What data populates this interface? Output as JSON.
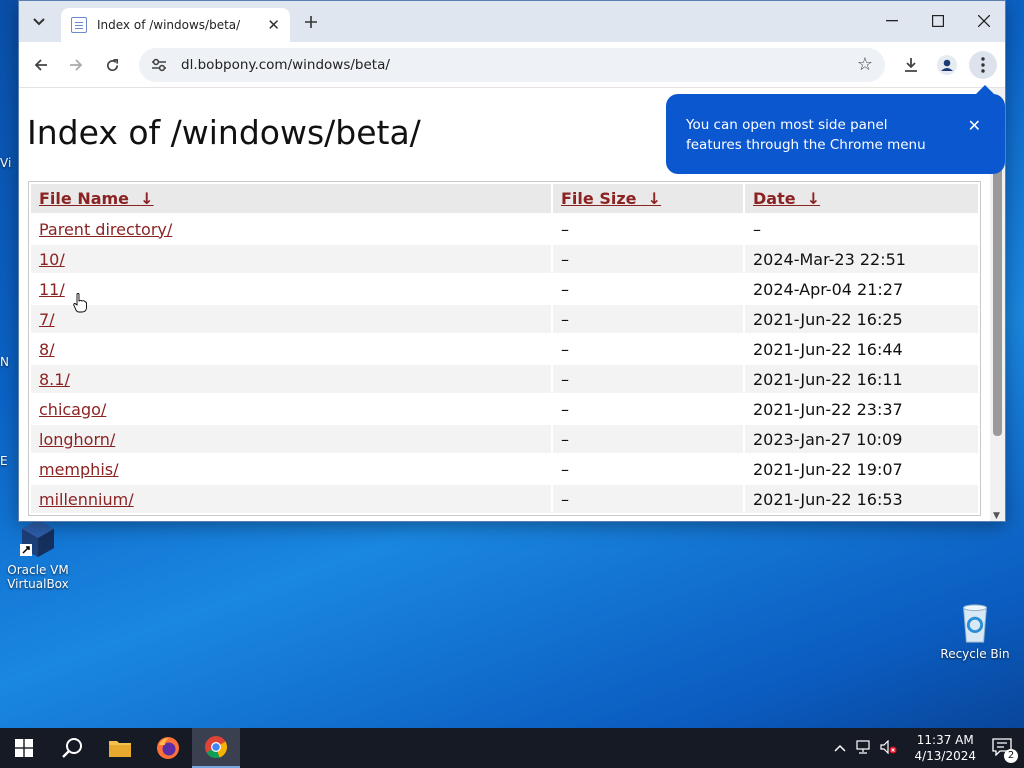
{
  "desktop": {
    "icons": [
      {
        "label": "Oracle VM VirtualBox"
      },
      {
        "label": "Recycle Bin"
      }
    ],
    "partial_labels": [
      "Vi",
      "N",
      "E"
    ]
  },
  "browser": {
    "tab_title": "Index of /windows/beta/",
    "url": "dl.bobpony.com/windows/beta/"
  },
  "promo": {
    "text": "You can open most side panel features through the Chrome menu"
  },
  "page": {
    "heading": "Index of /windows/beta/",
    "columns": {
      "name": "File Name",
      "size": "File Size",
      "date": "Date",
      "sort_arrow": "↓"
    },
    "rows": [
      {
        "name": "Parent directory/",
        "size": "–",
        "date": "–"
      },
      {
        "name": "10/",
        "size": "–",
        "date": "2024-Mar-23 22:51"
      },
      {
        "name": "11/",
        "size": "–",
        "date": "2024-Apr-04 21:27"
      },
      {
        "name": "7/",
        "size": "–",
        "date": "2021-Jun-22 16:25"
      },
      {
        "name": "8/",
        "size": "–",
        "date": "2021-Jun-22 16:44"
      },
      {
        "name": "8.1/",
        "size": "–",
        "date": "2021-Jun-22 16:11"
      },
      {
        "name": "chicago/",
        "size": "–",
        "date": "2021-Jun-22 23:37"
      },
      {
        "name": "longhorn/",
        "size": "–",
        "date": "2023-Jan-27 10:09"
      },
      {
        "name": "memphis/",
        "size": "–",
        "date": "2021-Jun-22 19:07"
      },
      {
        "name": "millennium/",
        "size": "–",
        "date": "2021-Jun-22 16:53"
      }
    ]
  },
  "taskbar": {
    "time": "11:37 AM",
    "date": "4/13/2024",
    "notification_count": "2"
  },
  "colors": {
    "link": "#8c2323",
    "promo": "#0b57d0",
    "taskbar": "#151a24"
  }
}
